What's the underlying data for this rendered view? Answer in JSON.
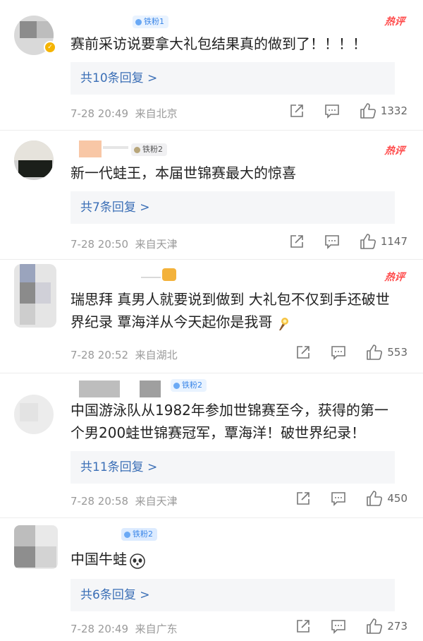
{
  "hot_label": "热评",
  "comments": [
    {
      "badge": "铁粉1",
      "text": "赛前采访说要拿大礼包结果真的做到了！！！！",
      "replies": "共10条回复 >",
      "time": "7-28 20:49",
      "location": "来自北京",
      "likes": "1332",
      "verified": true
    },
    {
      "badge": "铁粉2",
      "text": "新一代蛙王，本届世锦赛最大的惊喜",
      "replies": "共7条回复 >",
      "time": "7-28 20:50",
      "location": "来自天津",
      "likes": "1147"
    },
    {
      "badge": "",
      "text": "瑞思拜 真男人就要说到做到 大礼包不仅到手还破世界纪录 覃海洋从今天起你是我哥",
      "replies": "",
      "time": "7-28 20:52",
      "location": "来自湖北",
      "likes": "553"
    },
    {
      "badge": "铁粉2",
      "text": "中国游泳队从1982年参加世锦赛至今，获得的第一个男200蛙世锦赛冠军，覃海洋！破世界纪录！",
      "replies": "共11条回复 >",
      "time": "7-28 20:58",
      "location": "来自天津",
      "likes": "450"
    },
    {
      "badge": "铁粉2",
      "text": "中国牛蛙",
      "replies": "共6条回复 >",
      "time": "7-28 20:49",
      "location": "来自广东",
      "likes": "273"
    }
  ],
  "icons": {
    "repost": "share-icon",
    "comment": "comment-icon",
    "like": "thumbs-up-icon",
    "hot": "hot-comment-badge"
  },
  "colors": {
    "reply_link": "#3b6fb6",
    "hot_red": "#ff4a4a",
    "meta_gray": "#9a9a9a"
  }
}
